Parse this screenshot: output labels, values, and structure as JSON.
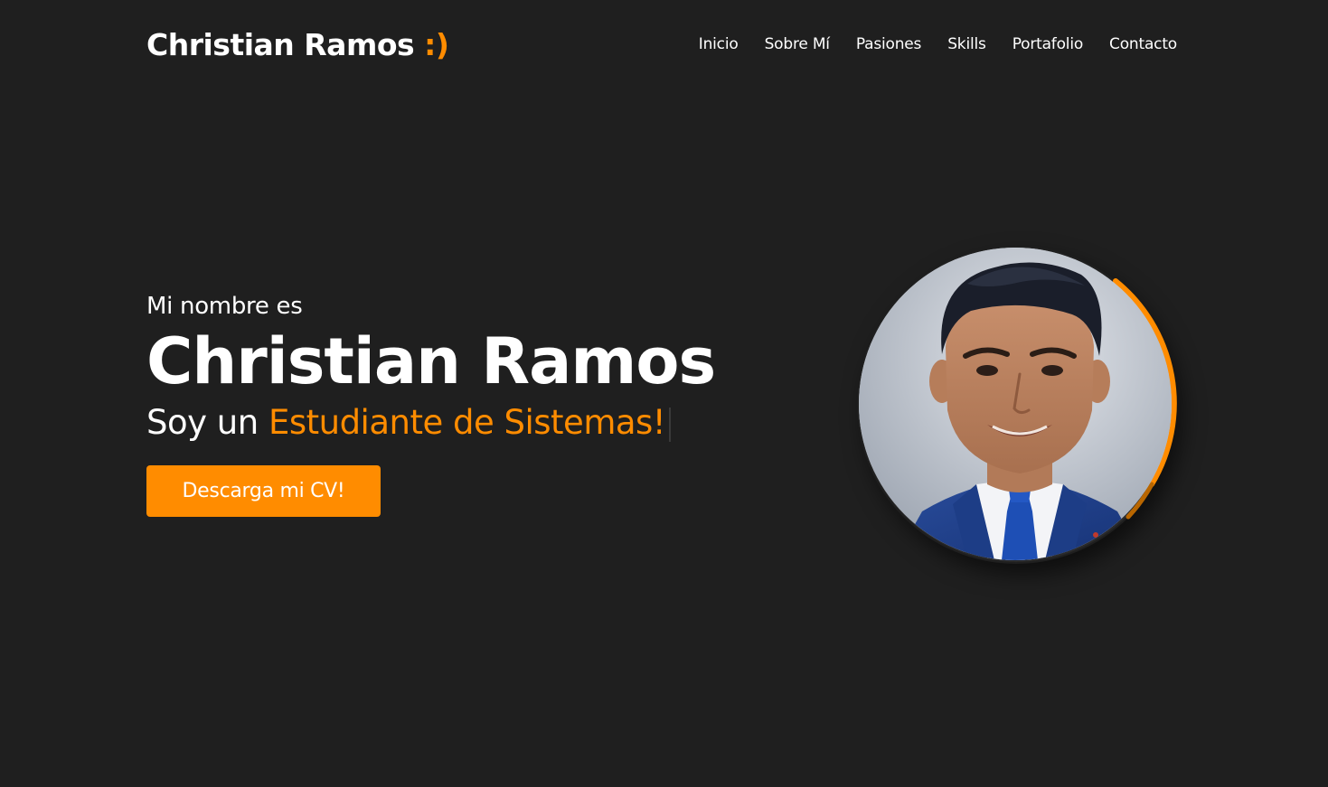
{
  "header": {
    "logo_text": "Christian Ramos",
    "logo_smile": ":)"
  },
  "nav": {
    "items": [
      "Inicio",
      "Sobre Mí",
      "Pasiones",
      "Skills",
      "Portafolio",
      "Contacto"
    ]
  },
  "hero": {
    "intro": "Mi nombre es",
    "name": "Christian Ramos",
    "role_prefix": "Soy un ",
    "role_highlight": "Estudiante de Sistemas!",
    "cta_label": "Descarga mi CV!"
  },
  "colors": {
    "background": "#1f1f1f",
    "accent": "#ff8c00",
    "text": "#ffffff"
  },
  "icons": {
    "avatar": "profile-photo"
  }
}
